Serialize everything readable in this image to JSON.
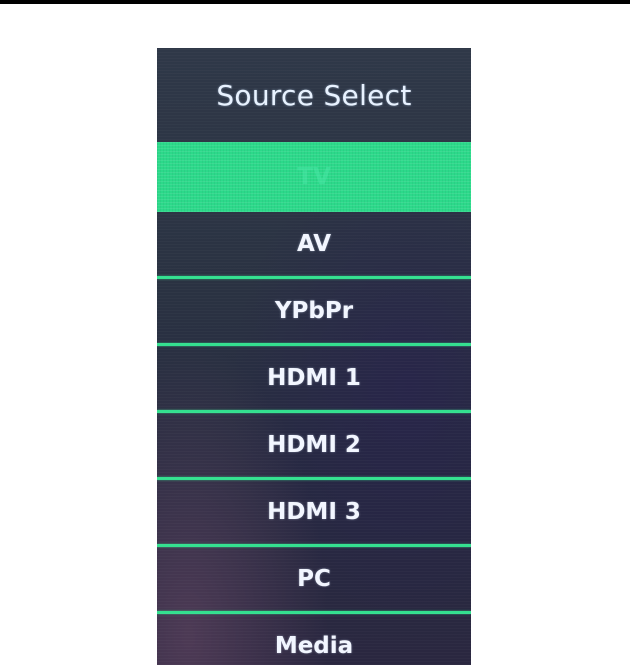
{
  "menu": {
    "title": "Source Select",
    "selected_index": 0,
    "items": [
      {
        "label": "TV",
        "selected": true
      },
      {
        "label": "AV",
        "selected": false
      },
      {
        "label": "YPbPr",
        "selected": false
      },
      {
        "label": "HDMI 1",
        "selected": false
      },
      {
        "label": "HDMI 2",
        "selected": false
      },
      {
        "label": "HDMI 3",
        "selected": false
      },
      {
        "label": "PC",
        "selected": false
      },
      {
        "label": "Media",
        "selected": false
      }
    ]
  },
  "colors": {
    "highlight": "#2cd98a",
    "divider": "#33e08f",
    "panel_background": "#2c3446",
    "text": "#f2f6ff"
  }
}
